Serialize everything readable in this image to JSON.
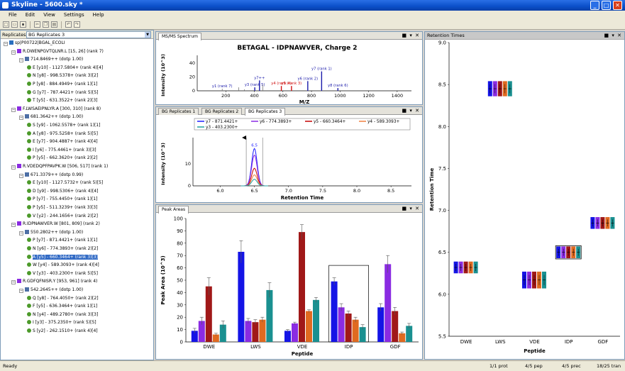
{
  "window": {
    "title": "Skyline - 5600.sky *"
  },
  "menu": [
    "File",
    "Edit",
    "View",
    "Settings",
    "Help"
  ],
  "tree": {
    "header_label": "Replicates:",
    "replicate_value": "BG Replicates 3",
    "rows": [
      {
        "d": 0,
        "k": "protein",
        "t": "sp|P00722|BGAL_ECOLI"
      },
      {
        "d": 1,
        "k": "peptide",
        "t": "R.DWENPGVTQLNR.L [15, 26] (rank 7)"
      },
      {
        "d": 2,
        "k": "prec",
        "t": "714.8469++ (dotp 1.00)"
      },
      {
        "d": 3,
        "k": "ion",
        "t": "E [y10] - 1127.5804+ (rank 4)[4]",
        "c": "#4c9a2a"
      },
      {
        "d": 3,
        "k": "ion",
        "t": "N [y8] - 998.5378+ (rank 3)[2]",
        "c": "#4c9a2a"
      },
      {
        "d": 3,
        "k": "ion",
        "t": "P [y8] - 884.4949+ (rank 1)[1]",
        "c": "#4c9a2a"
      },
      {
        "d": 3,
        "k": "ion",
        "t": "G [y7] - 787.4421+ (rank 5)[5]",
        "c": "#4c9a2a"
      },
      {
        "d": 3,
        "k": "ion",
        "t": "T [y5] - 631.3522+ (rank 2)[3]",
        "c": "#4c9a2a"
      },
      {
        "d": 1,
        "k": "peptide",
        "t": "F.LWSAEIPNLYR.A [300, 310] (rank 8)"
      },
      {
        "d": 2,
        "k": "prec",
        "t": "681.3642++ (dotp 1.00)"
      },
      {
        "d": 3,
        "k": "ion",
        "t": "S [y9] - 1062.5578+ (rank 1)[1]",
        "c": "#4c9a2a"
      },
      {
        "d": 3,
        "k": "ion",
        "t": "A [y8] - 975.5258+ (rank 5)[5]",
        "c": "#4c9a2a"
      },
      {
        "d": 3,
        "k": "ion",
        "t": "E [y7] - 904.4887+ (rank 4)[4]",
        "c": "#4c9a2a"
      },
      {
        "d": 3,
        "k": "ion",
        "t": "I [y6] - 775.4461+ (rank 3)[3]",
        "c": "#4c9a2a"
      },
      {
        "d": 3,
        "k": "ion",
        "t": "P [y5] - 662.3620+ (rank 2)[2]",
        "c": "#4c9a2a"
      },
      {
        "d": 1,
        "k": "peptide",
        "t": "R.VDEDQPFPAVPK.W [506, 517] (rank 1)"
      },
      {
        "d": 2,
        "k": "prec",
        "t": "671.3379++ (dotp 0.99)"
      },
      {
        "d": 3,
        "k": "ion",
        "t": "E [y10] - 1127.5732+ (rank 5)[5]",
        "c": "#4c9a2a"
      },
      {
        "d": 3,
        "k": "ion",
        "t": "D [y9] - 998.5306+ (rank 4)[4]",
        "c": "#4c9a2a"
      },
      {
        "d": 3,
        "k": "ion",
        "t": "P [y7] - 755.4450+ (rank 1)[1]",
        "c": "#4c9a2a"
      },
      {
        "d": 3,
        "k": "ion",
        "t": "P [y5] - 511.3239+ (rank 3)[3]",
        "c": "#4c9a2a"
      },
      {
        "d": 3,
        "k": "ion",
        "t": "V [y2] - 244.1656+ (rank 2)[2]",
        "c": "#4c9a2a"
      },
      {
        "d": 1,
        "k": "peptide",
        "t": "R.IDPNAWVER.W [801, 809] (rank 2)"
      },
      {
        "d": 2,
        "k": "prec",
        "t": "550.2802++ (dotp 1.00)"
      },
      {
        "d": 3,
        "k": "ion",
        "t": "P [y7] - 871.4421+ (rank 1)[1]",
        "c": "#4c9a2a"
      },
      {
        "d": 3,
        "k": "ion",
        "t": "N [y6] - 774.3893+ (rank 2)[2]",
        "c": "#4c9a2a"
      },
      {
        "d": 3,
        "k": "ion",
        "t": "A [y5] - 660.3464+ (rank 3)[3]",
        "c": "#4c9a2a",
        "sel": true
      },
      {
        "d": 3,
        "k": "ion",
        "t": "W [y4] - 589.3093+ (rank 4)[4]",
        "c": "#4c9a2a"
      },
      {
        "d": 3,
        "k": "ion",
        "t": "V [y3] - 403.2300+ (rank 5)[5]",
        "c": "#4c9a2a"
      },
      {
        "d": 1,
        "k": "peptide",
        "t": "R.GDFQFNISR.Y [953, 961] (rank 4)"
      },
      {
        "d": 2,
        "k": "prec",
        "t": "542.2645++ (dotp 1.00)"
      },
      {
        "d": 3,
        "k": "ion",
        "t": "Q [y8] - 764.4050+ (rank 2)[2]",
        "c": "#4c9a2a"
      },
      {
        "d": 3,
        "k": "ion",
        "t": "F [y5] - 636.3464+ (rank 1)[1]",
        "c": "#4c9a2a"
      },
      {
        "d": 3,
        "k": "ion",
        "t": "N [y4] - 489.2780+ (rank 3)[3]",
        "c": "#4c9a2a"
      },
      {
        "d": 3,
        "k": "ion",
        "t": "I [y3] - 375.2350+ (rank 5)[5]",
        "c": "#4c9a2a"
      },
      {
        "d": 3,
        "k": "ion",
        "t": "S [y2] - 262.1510+ (rank 4)[4]",
        "c": "#4c9a2a"
      }
    ]
  },
  "msms": {
    "tab": "MS/MS Spectrum"
  },
  "chrom": {
    "tabs": [
      "BG Replicates 1",
      "BG Replicates 2",
      "BG Replicates 3"
    ]
  },
  "areas": {
    "tab": "Peak Areas"
  },
  "rt": {
    "tab": "Retention Times"
  },
  "panel_controls": "■ ▾ ✕",
  "status": {
    "ready": "Ready",
    "prot": "1/1 prot",
    "pep": "4/5 pep",
    "prec": "4/5 prec",
    "tran": "18/25 tran"
  },
  "chart_data": [
    {
      "type": "bar",
      "title": "BETAGAL - IDPNAWVER, Charge 2",
      "xlabel": "M/Z",
      "ylabel": "Intensity (10^3)",
      "xlim": [
        0,
        1500
      ],
      "ylim": [
        0,
        45
      ],
      "xticks": [
        200,
        400,
        600,
        800,
        1000,
        1200,
        1400
      ],
      "yticks": [
        0,
        20,
        40
      ],
      "peaks": [
        {
          "x": 175,
          "y": 3
        },
        {
          "x": 290,
          "y": 5
        },
        {
          "x": 330,
          "y": 2
        },
        {
          "x": 403,
          "y": 5,
          "label": "y3 (rank 5)"
        },
        {
          "x": 436,
          "y": 15,
          "label": "y7++"
        },
        {
          "x": 459,
          "y": 9
        },
        {
          "x": 589,
          "y": 7,
          "label": "y4 (rank 4)",
          "hl": true
        },
        {
          "x": 660,
          "y": 7,
          "label": "y5 (rank 3)",
          "hl": true
        },
        {
          "x": 774,
          "y": 14,
          "label": "y6 (rank 2)"
        },
        {
          "x": 871,
          "y": 28,
          "label": "y7 (rank 1)"
        },
        {
          "x": 985,
          "y": 4,
          "label": "y8 (rank 6)"
        }
      ],
      "peak_labels_extra": {
        "y1": "y1 (rank 7)"
      }
    },
    {
      "type": "line",
      "xlabel": "Retention Time",
      "ylabel": "Intensity (10^3)",
      "xlim": [
        5.6,
        8.8
      ],
      "ylim": [
        0,
        20
      ],
      "xticks": [
        6.0,
        6.5,
        7.0,
        7.5,
        8.0,
        8.5
      ],
      "yticks": [
        0,
        10
      ],
      "apex_label": "6.5",
      "series": [
        {
          "name": "y7 - 871.4421+",
          "color": "#1a1aff",
          "h": 17
        },
        {
          "name": "y6 - 774.3893+",
          "color": "#8a2be2",
          "h": 14
        },
        {
          "name": "y5 - 660.3464+",
          "color": "#c40000",
          "h": 8
        },
        {
          "name": "y4 - 589.3093+",
          "color": "#f08040",
          "h": 5
        },
        {
          "name": "y3 - 403.2300+",
          "color": "#20a0a0",
          "h": 3
        }
      ]
    },
    {
      "type": "bar",
      "xlabel": "Peptide",
      "ylabel": "Peak Area (10^3)",
      "ylim": [
        0,
        100
      ],
      "yticks": [
        0,
        10,
        20,
        30,
        40,
        50,
        60,
        70,
        80,
        90,
        100
      ],
      "categories": [
        "DWE",
        "LWS",
        "VDE",
        "IDP",
        "GDF"
      ],
      "colors": [
        "#1414e6",
        "#8a2be2",
        "#a01818",
        "#e06a20",
        "#1a9090"
      ],
      "values": [
        [
          9,
          17,
          45,
          6,
          14
        ],
        [
          73,
          17,
          16,
          18,
          42
        ],
        [
          9,
          15,
          89,
          25,
          34
        ],
        [
          49,
          28,
          23,
          18,
          12
        ],
        [
          28,
          63,
          25,
          7,
          13
        ]
      ],
      "errors": [
        [
          2,
          3,
          7,
          1,
          3
        ],
        [
          9,
          2,
          2,
          2,
          6
        ],
        [
          1,
          1,
          6,
          1,
          2
        ],
        [
          3,
          3,
          2,
          2,
          2
        ],
        [
          3,
          7,
          3,
          1,
          2
        ]
      ],
      "selected": "IDP"
    },
    {
      "type": "bar",
      "xlabel": "Peptide",
      "ylabel": "Retention Time",
      "ylim": [
        5.5,
        9.0
      ],
      "yticks": [
        5.5,
        6.0,
        6.5,
        7.0,
        7.5,
        8.0,
        8.5,
        9.0
      ],
      "categories": [
        "DWE",
        "LWS",
        "VDE",
        "IDP",
        "GDF"
      ],
      "rt_center": [
        6.32,
        8.45,
        6.17,
        6.5,
        6.85
      ],
      "rt_halfwidth": [
        0.07,
        0.09,
        0.1,
        0.07,
        0.07
      ],
      "colors": [
        "#1414e6",
        "#8a2be2",
        "#a01818",
        "#e06a20",
        "#1a9090"
      ],
      "selected": "IDP"
    }
  ]
}
